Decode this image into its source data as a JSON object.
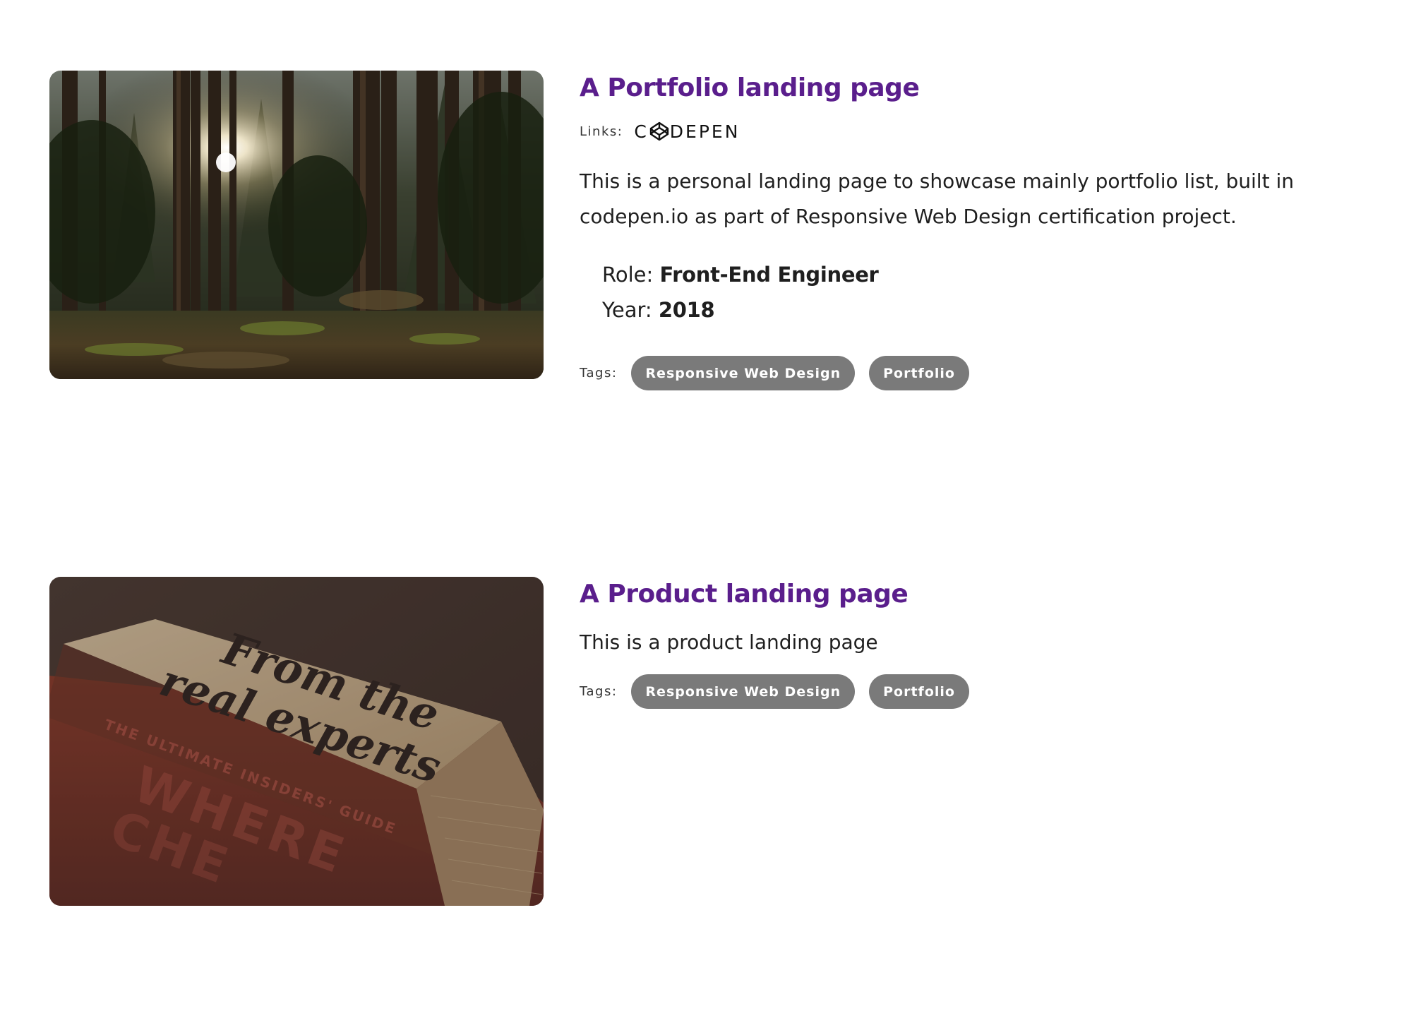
{
  "projects": [
    {
      "title": "A Portfolio landing page",
      "links_label": "Links:",
      "link_name": "CODEPEN",
      "description": "This is a personal landing page to showcase mainly portfolio list, built in codepen.io as part of Responsive Web Design certification project.",
      "role_label": "Role:",
      "role_value": "Front-End Engineer",
      "year_label": "Year:",
      "year_value": "2018",
      "tags_label": "Tags:",
      "tags": [
        "Responsive Web Design",
        "Portfolio"
      ],
      "thumbnail": "forest-image"
    },
    {
      "title": "A Product landing page",
      "description": "This is a product landing page",
      "tags_label": "Tags:",
      "tags": [
        "Responsive Web Design",
        "Portfolio"
      ],
      "thumbnail": "book-image",
      "thumbnail_text": {
        "script_line_1": "From the",
        "script_line_2": "real experts",
        "spine_line": "THE ULTIMATE INSIDERS' GUIDE",
        "cover_line_1": "WHERE",
        "cover_line_2": "CHE"
      }
    }
  ],
  "colors": {
    "title": "#5a1e8c",
    "tag_bg": "#7a7a7a",
    "tag_text": "#ffffff",
    "body_text": "#1f1f1f"
  }
}
